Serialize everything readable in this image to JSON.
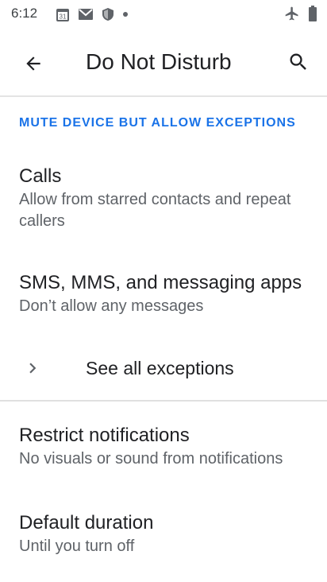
{
  "status_bar": {
    "time": "6:12",
    "left_icons": [
      "calendar-icon",
      "gmail-icon",
      "shield-icon",
      "dot-icon"
    ],
    "right_icons": [
      "airplane-icon",
      "battery-icon"
    ],
    "calendar_day": "31"
  },
  "app_bar": {
    "title": "Do Not Disturb",
    "back_icon": "back-arrow-icon",
    "search_icon": "search-icon"
  },
  "section": {
    "header": "MUTE DEVICE BUT ALLOW EXCEPTIONS"
  },
  "items": [
    {
      "title": "Calls",
      "subtitle": "Allow from starred contacts and repeat callers"
    },
    {
      "title": "SMS, MMS, and messaging apps",
      "subtitle": "Don’t allow any messages"
    }
  ],
  "exceptions": {
    "label": "See all exceptions",
    "icon": "chevron-right-icon"
  },
  "settings": [
    {
      "title": "Restrict notifications",
      "subtitle": "No visuals or sound from notifications"
    },
    {
      "title": "Default duration",
      "subtitle": "Until you turn off"
    }
  ],
  "colors": {
    "accent": "#1a73e8",
    "text_primary": "#202124",
    "text_secondary": "#5f6368"
  }
}
